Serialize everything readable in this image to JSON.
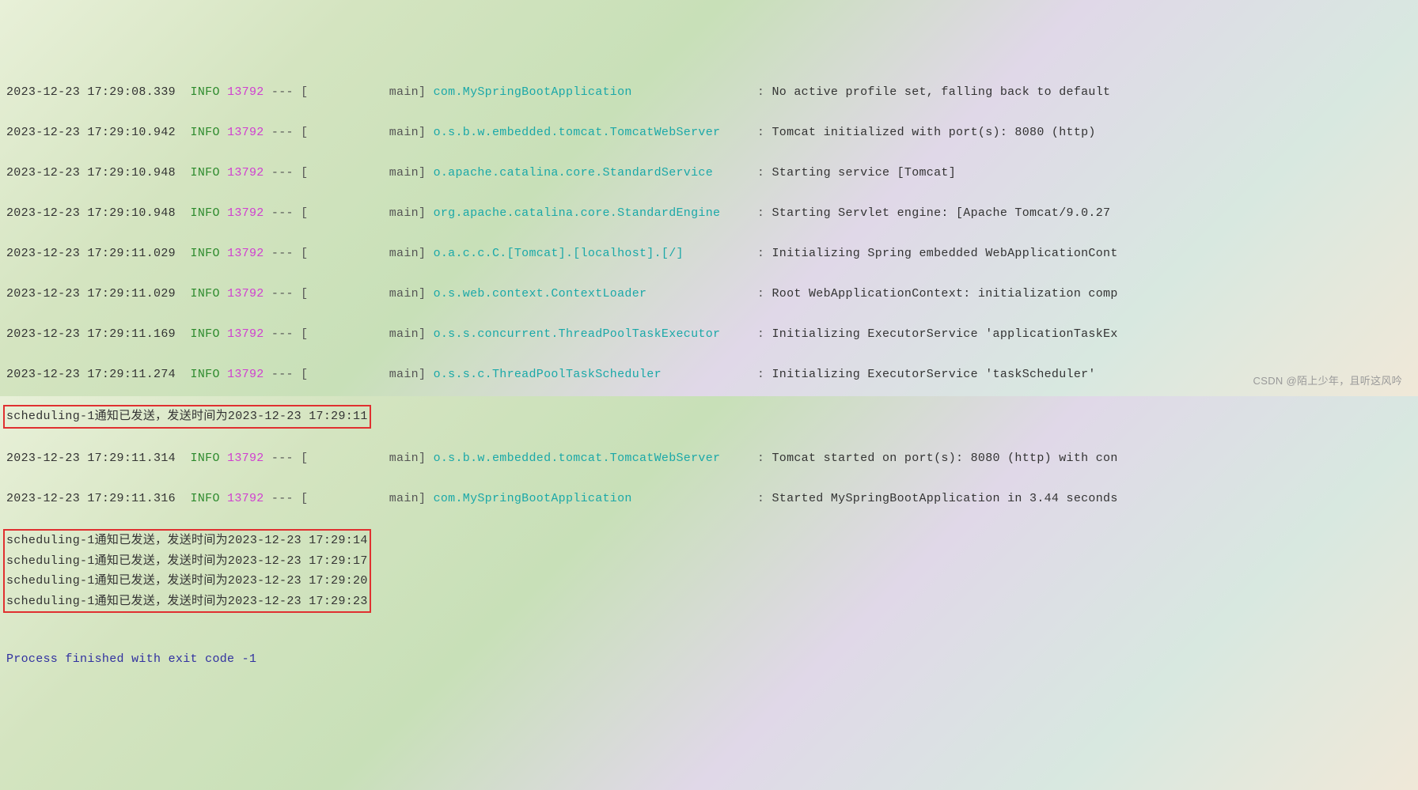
{
  "logs": [
    {
      "ts": "2023-12-23 17:29:08.339",
      "level": "INFO",
      "pid": "13792",
      "sep": "--- [",
      "thread": "           main]",
      "logger": "com.MySpringBootApplication                ",
      "msg": "No active profile set, falling back to default"
    },
    {
      "ts": "2023-12-23 17:29:10.942",
      "level": "INFO",
      "pid": "13792",
      "sep": "--- [",
      "thread": "           main]",
      "logger": "o.s.b.w.embedded.tomcat.TomcatWebServer    ",
      "msg": "Tomcat initialized with port(s): 8080 (http)"
    },
    {
      "ts": "2023-12-23 17:29:10.948",
      "level": "INFO",
      "pid": "13792",
      "sep": "--- [",
      "thread": "           main]",
      "logger": "o.apache.catalina.core.StandardService     ",
      "msg": "Starting service [Tomcat]"
    },
    {
      "ts": "2023-12-23 17:29:10.948",
      "level": "INFO",
      "pid": "13792",
      "sep": "--- [",
      "thread": "           main]",
      "logger": "org.apache.catalina.core.StandardEngine    ",
      "msg": "Starting Servlet engine: [Apache Tomcat/9.0.27"
    },
    {
      "ts": "2023-12-23 17:29:11.029",
      "level": "INFO",
      "pid": "13792",
      "sep": "--- [",
      "thread": "           main]",
      "logger": "o.a.c.c.C.[Tomcat].[localhost].[/]         ",
      "msg": "Initializing Spring embedded WebApplicationCont"
    },
    {
      "ts": "2023-12-23 17:29:11.029",
      "level": "INFO",
      "pid": "13792",
      "sep": "--- [",
      "thread": "           main]",
      "logger": "o.s.web.context.ContextLoader              ",
      "msg": "Root WebApplicationContext: initialization comp"
    },
    {
      "ts": "2023-12-23 17:29:11.169",
      "level": "INFO",
      "pid": "13792",
      "sep": "--- [",
      "thread": "           main]",
      "logger": "o.s.s.concurrent.ThreadPoolTaskExecutor    ",
      "msg": "Initializing ExecutorService 'applicationTaskEx"
    },
    {
      "ts": "2023-12-23 17:29:11.274",
      "level": "INFO",
      "pid": "13792",
      "sep": "--- [",
      "thread": "           main]",
      "logger": "o.s.s.c.ThreadPoolTaskScheduler            ",
      "msg": "Initializing ExecutorService 'taskScheduler'"
    }
  ],
  "sched1": "scheduling-1通知已发送，发送时间为2023-12-23 17:29:11",
  "logs2": [
    {
      "ts": "2023-12-23 17:29:11.314",
      "level": "INFO",
      "pid": "13792",
      "sep": "--- [",
      "thread": "           main]",
      "logger": "o.s.b.w.embedded.tomcat.TomcatWebServer    ",
      "msg": "Tomcat started on port(s): 8080 (http) with con"
    },
    {
      "ts": "2023-12-23 17:29:11.316",
      "level": "INFO",
      "pid": "13792",
      "sep": "--- [",
      "thread": "           main]",
      "logger": "com.MySpringBootApplication                ",
      "msg": "Started MySpringBootApplication in 3.44 seconds"
    }
  ],
  "sched_block": [
    "scheduling-1通知已发送，发送时间为2023-12-23 17:29:14",
    "scheduling-1通知已发送，发送时间为2023-12-23 17:29:17",
    "scheduling-1通知已发送，发送时间为2023-12-23 17:29:20",
    "scheduling-1通知已发送，发送时间为2023-12-23 17:29:23"
  ],
  "exit": "Process finished with exit code -1",
  "watermark": "CSDN @陌上少年，且听这风吟"
}
